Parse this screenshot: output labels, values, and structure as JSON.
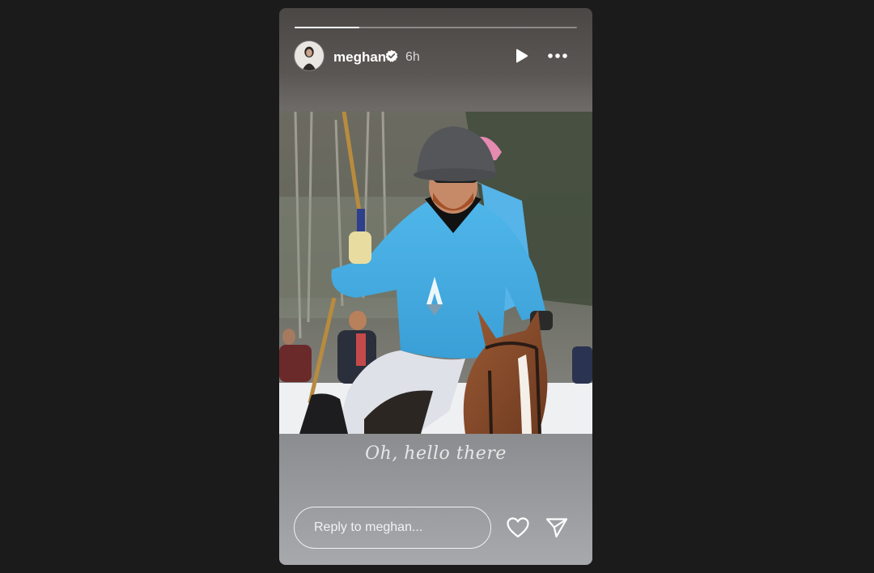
{
  "story": {
    "progress_fraction": 0.23,
    "user": {
      "username": "meghan",
      "verified": true,
      "time_ago": "6h",
      "avatar_icon": "avatar-photo"
    },
    "controls": {
      "play_icon": "play-icon",
      "more_icon": "more-dots-icon"
    },
    "media": {
      "description_icon": "story-photo"
    },
    "caption": "Oh, hello there",
    "reply": {
      "placeholder": "Reply to meghan..."
    },
    "actions": {
      "like_icon": "heart-icon",
      "share_icon": "send-icon"
    }
  },
  "colors": {
    "background": "#1b1b1b",
    "progress_track": "#8a8a8a",
    "progress_fill": "#ffffff",
    "text": "#ffffff"
  }
}
